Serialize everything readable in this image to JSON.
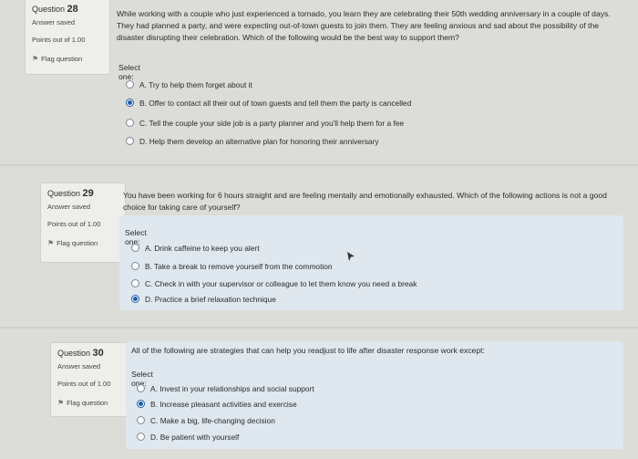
{
  "questions": [
    {
      "label": "Question",
      "number": "28",
      "state": "Answer saved",
      "points": "Points out of 1.00",
      "flag": "Flag question",
      "text": "While working with a couple who just experienced a tornado, you learn they are celebrating their 50th wedding anniversary in a couple of days. They had planned a party, and were expecting out-of-town guests to join them. They are feeling anxious and sad about the possibility of the disaster disrupting their celebration. Which of the following would be the best way to support them?",
      "prompt": "Select one:",
      "options": [
        {
          "label": "A. Try to help them forget about it",
          "selected": false
        },
        {
          "label": "B. Offer to contact all their out of town guests and tell them the party is cancelled",
          "selected": true
        },
        {
          "label": "C. Tell the couple your side job is a party planner and you'll help them for a fee",
          "selected": false
        },
        {
          "label": "D. Help them develop an alternative plan for honoring their anniversary",
          "selected": false
        }
      ]
    },
    {
      "label": "Question",
      "number": "29",
      "state": "Answer saved",
      "points": "Points out of 1.00",
      "flag": "Flag question",
      "text": "You have been working for 6 hours straight and are feeling mentally and emotionally exhausted. Which of the following actions is not a good choice for taking care of yourself?",
      "prompt": "Select one:",
      "options": [
        {
          "label": "A. Drink caffeine to keep you alert",
          "selected": false
        },
        {
          "label": "B. Take a break to remove yourself from the commotion",
          "selected": false
        },
        {
          "label": "C. Check in with your supervisor or colleague to let them know you need a break",
          "selected": false
        },
        {
          "label": "D. Practice a brief relaxation technique",
          "selected": true
        }
      ]
    },
    {
      "label": "Question",
      "number": "30",
      "state": "Answer saved",
      "points": "Points out of 1.00",
      "flag": "Flag question",
      "text": "All of the following are strategies that can help you readjust to life after disaster response work except:",
      "prompt": "Select one:",
      "options": [
        {
          "label": "A. Invest in your relationships and social support",
          "selected": false
        },
        {
          "label": "B. Increase pleasant activities and exercise",
          "selected": true
        },
        {
          "label": "C. Make a big, life-changing decision",
          "selected": false
        },
        {
          "label": "D. Be patient with yourself",
          "selected": false
        }
      ]
    }
  ]
}
